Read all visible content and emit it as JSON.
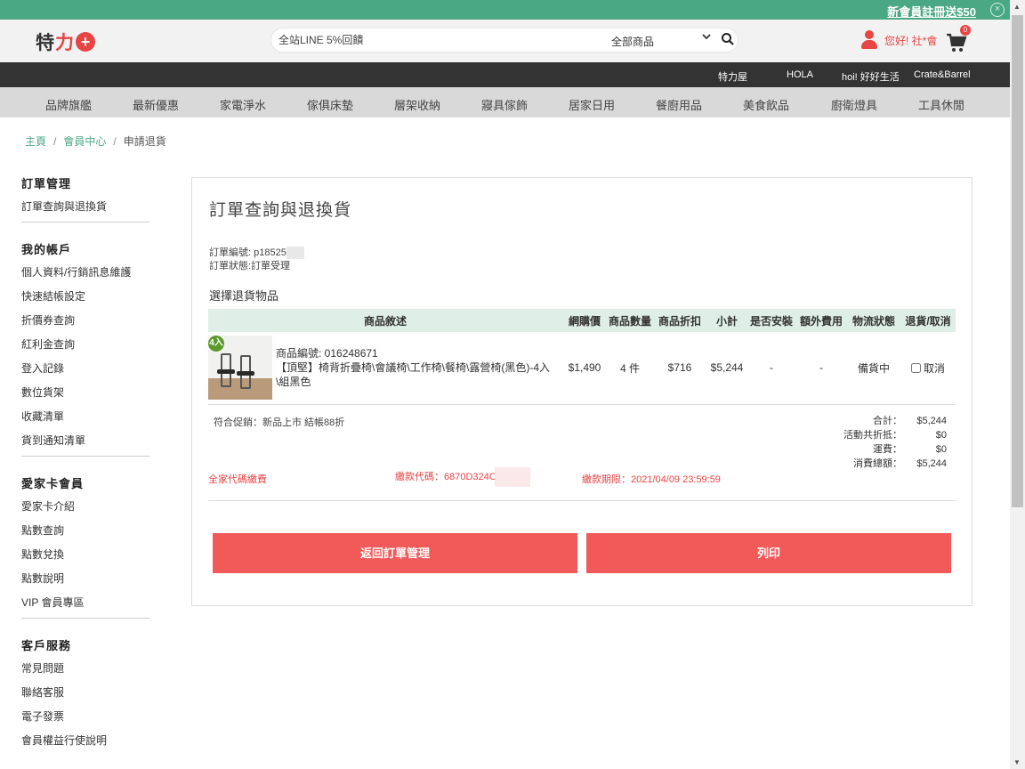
{
  "promo": {
    "link": "新會員註冊送$50",
    "close": "×"
  },
  "header": {
    "logo_main": "特",
    "logo_red": "力",
    "logo_plus": "+",
    "search_placeholder": "全站LINE 5%回饋",
    "search_scope": "全部商品",
    "greeting": "您好! 社*會",
    "cart_count": "0"
  },
  "sister_sites": [
    "特力屋",
    "HOLA",
    "hoi! 好好生活",
    "Crate&Barrel"
  ],
  "categories": [
    "品牌旗艦",
    "最新優惠",
    "家電淨水",
    "傢俱床墊",
    "層架收納",
    "寢具傢飾",
    "居家日用",
    "餐廚用品",
    "美食飲品",
    "廚衛燈具",
    "工具休閒"
  ],
  "breadcrumb": {
    "home": "主頁",
    "member": "會員中心",
    "current": "申請退貨",
    "sep": "/"
  },
  "sidebar": [
    {
      "title": "訂單管理",
      "items": [
        "訂單查詢與退換貨"
      ]
    },
    {
      "title": "我的帳戶",
      "items": [
        "個人資料/行銷訊息維護",
        "快速結帳設定",
        "折價券查詢",
        "紅利金查詢",
        "登入記錄",
        "數位貨架",
        "收藏清單",
        "貨到通知清單"
      ]
    },
    {
      "title": "愛家卡會員",
      "items": [
        "愛家卡介紹",
        "點數查詢",
        "點數兌換",
        "點數說明",
        "VIP 會員專區"
      ]
    },
    {
      "title": "客戶服務",
      "items": [
        "常見問題",
        "聯絡客服",
        "電子發票",
        "會員權益行使說明"
      ]
    }
  ],
  "panel": {
    "title": "訂單查詢與退換貨",
    "order_no": "訂單編號: p18525",
    "order_status": "訂單狀態:訂單受理",
    "section": "選擇退貨物品"
  },
  "table": {
    "headers": [
      "商品敘述",
      "網購價",
      "商品數量",
      "商品折扣",
      "小計",
      "是否安裝",
      "額外費用",
      "物流狀態",
      "退貨/取消"
    ],
    "row": {
      "badge": "4入",
      "sku": "商品編號: 016248671",
      "name": "【頂堅】椅背折疊椅\\會議椅\\工作椅\\餐椅\\露營椅(黑色)-4入\\組黑色",
      "price": "$1,490",
      "qty": "4 件",
      "discount": "$716",
      "subtotal": "$5,244",
      "install": "-",
      "extra": "-",
      "logistics": "備貨中",
      "cancel": "取消"
    }
  },
  "summary": {
    "promo_note": "符合促銷：新品上市 結帳88折",
    "rows": [
      {
        "label": "合計：",
        "value": "$5,244"
      },
      {
        "label": "活動共折抵：",
        "value": "$0"
      },
      {
        "label": "運費：",
        "value": "$0"
      },
      {
        "label": "消費總額：",
        "value": "$5,244"
      }
    ]
  },
  "payment": {
    "method": "全家代碼繳費",
    "code": "繳款代碼：6870D324C",
    "deadline": "繳款期限：2021/04/09 23:59:59"
  },
  "buttons": {
    "back": "返回訂單管理",
    "print": "列印"
  },
  "colors": {
    "brand_green": "#4aa884",
    "accent_red": "#e84545",
    "button_red": "#f25a5a",
    "header_bar": "#333333"
  }
}
